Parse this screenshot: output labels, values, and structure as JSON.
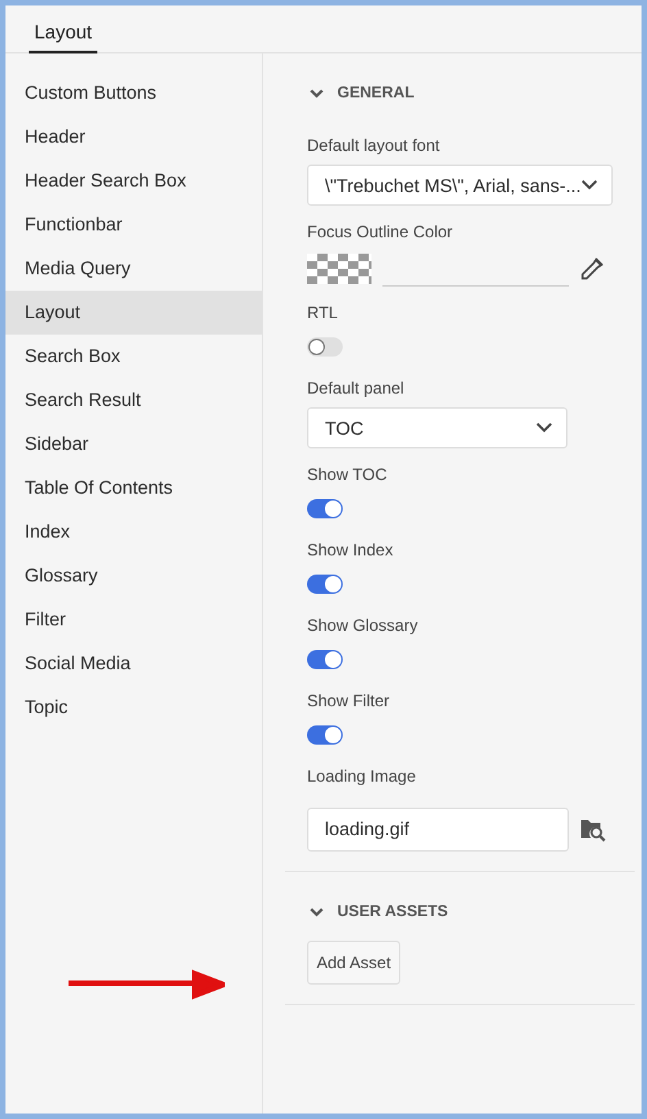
{
  "tabs": [
    {
      "label": "Layout",
      "selected": true
    }
  ],
  "sidebar": {
    "items": [
      {
        "label": "Custom Buttons",
        "selected": false
      },
      {
        "label": "Header",
        "selected": false
      },
      {
        "label": "Header Search Box",
        "selected": false
      },
      {
        "label": "Functionbar",
        "selected": false
      },
      {
        "label": "Media Query",
        "selected": false
      },
      {
        "label": "Layout",
        "selected": true
      },
      {
        "label": "Search Box",
        "selected": false
      },
      {
        "label": "Search Result",
        "selected": false
      },
      {
        "label": "Sidebar",
        "selected": false
      },
      {
        "label": "Table Of Contents",
        "selected": false
      },
      {
        "label": "Index",
        "selected": false
      },
      {
        "label": "Glossary",
        "selected": false
      },
      {
        "label": "Filter",
        "selected": false
      },
      {
        "label": "Social Media",
        "selected": false
      },
      {
        "label": "Topic",
        "selected": false
      }
    ]
  },
  "sections": [
    {
      "title": "GENERAL",
      "expanded": true,
      "fields": [
        {
          "kind": "select",
          "label": "Default layout font",
          "value": "\\\"Trebuchet MS\\\", Arial, sans-...",
          "wide": true
        },
        {
          "kind": "color",
          "label": "Focus Outline Color"
        },
        {
          "kind": "toggle",
          "label": "RTL",
          "on": false
        },
        {
          "kind": "select",
          "label": "Default panel",
          "value": "TOC",
          "wide": false
        },
        {
          "kind": "toggle",
          "label": "Show TOC",
          "on": true
        },
        {
          "kind": "toggle",
          "label": "Show Index",
          "on": true
        },
        {
          "kind": "toggle",
          "label": "Show Glossary",
          "on": true
        },
        {
          "kind": "toggle",
          "label": "Show Filter",
          "on": true
        },
        {
          "kind": "file",
          "label": "Loading Image",
          "value": "loading.gif"
        }
      ]
    },
    {
      "title": "USER ASSETS",
      "expanded": true,
      "button": "Add Asset"
    }
  ]
}
